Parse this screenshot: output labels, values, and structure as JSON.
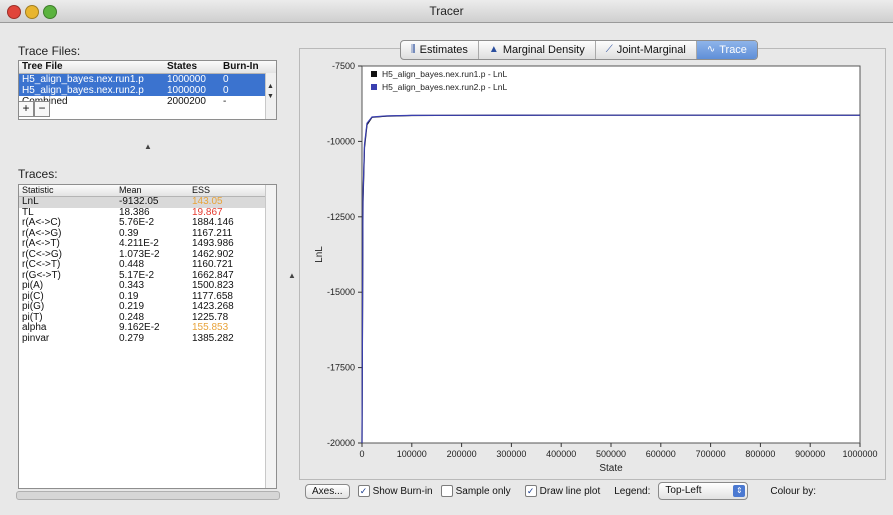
{
  "window": {
    "title": "Tracer"
  },
  "left": {
    "trace_files_label": "Trace Files:",
    "files_header": {
      "file": "Tree File",
      "states": "States",
      "burnin": "Burn-In"
    },
    "files": [
      {
        "file": "H5_align_bayes.nex.run1.p",
        "states": "1000000",
        "burnin": "0",
        "selected": true
      },
      {
        "file": "H5_align_bayes.nex.run2.p",
        "states": "1000000",
        "burnin": "0",
        "selected": true
      },
      {
        "file": "Combined",
        "states": "2000200",
        "burnin": "-",
        "selected": false
      }
    ],
    "add_label": "+",
    "remove_label": "−",
    "traces_label": "Traces:",
    "traces_header": {
      "stat": "Statistic",
      "mean": "Mean",
      "ess": "ESS"
    },
    "traces": [
      {
        "stat": "LnL",
        "mean": "-9132.05",
        "ess": "143.05",
        "ess_color": "#e8a33a"
      },
      {
        "stat": "TL",
        "mean": "18.386",
        "ess": "19.867",
        "ess_color": "#e53a2f"
      },
      {
        "stat": "r(A<->C)",
        "mean": "5.76E-2",
        "ess": "1884.146",
        "ess_color": "#111111"
      },
      {
        "stat": "r(A<->G)",
        "mean": "0.39",
        "ess": "1167.211",
        "ess_color": "#111111"
      },
      {
        "stat": "r(A<->T)",
        "mean": "4.211E-2",
        "ess": "1493.986",
        "ess_color": "#111111"
      },
      {
        "stat": "r(C<->G)",
        "mean": "1.073E-2",
        "ess": "1462.902",
        "ess_color": "#111111"
      },
      {
        "stat": "r(C<->T)",
        "mean": "0.448",
        "ess": "1160.721",
        "ess_color": "#111111"
      },
      {
        "stat": "r(G<->T)",
        "mean": "5.17E-2",
        "ess": "1662.847",
        "ess_color": "#111111"
      },
      {
        "stat": "pi(A)",
        "mean": "0.343",
        "ess": "1500.823",
        "ess_color": "#111111"
      },
      {
        "stat": "pi(C)",
        "mean": "0.19",
        "ess": "1177.658",
        "ess_color": "#111111"
      },
      {
        "stat": "pi(G)",
        "mean": "0.219",
        "ess": "1423.268",
        "ess_color": "#111111"
      },
      {
        "stat": "pi(T)",
        "mean": "0.248",
        "ess": "1225.78",
        "ess_color": "#111111"
      },
      {
        "stat": "alpha",
        "mean": "9.162E-2",
        "ess": "155.853",
        "ess_color": "#e8a33a"
      },
      {
        "stat": "pinvar",
        "mean": "0.279",
        "ess": "1385.282",
        "ess_color": "#111111"
      }
    ]
  },
  "tabs": [
    {
      "label": "Estimates",
      "icon": "estimates-icon",
      "glyph": "⫼",
      "active": false
    },
    {
      "label": "Marginal Density",
      "icon": "marginal-density-icon",
      "glyph": "▲",
      "active": false
    },
    {
      "label": "Joint-Marginal",
      "icon": "joint-marginal-icon",
      "glyph": "⟋",
      "active": false
    },
    {
      "label": "Trace",
      "icon": "trace-icon",
      "glyph": "∿",
      "active": true
    }
  ],
  "chart_data": {
    "type": "line",
    "xlabel": "State",
    "ylabel": "LnL",
    "xlim": [
      0,
      1000000
    ],
    "ylim": [
      -20000,
      -7500
    ],
    "x_ticks": [
      0,
      100000,
      200000,
      300000,
      400000,
      500000,
      600000,
      700000,
      800000,
      900000,
      1000000
    ],
    "x_tick_labels": [
      "0",
      "100000",
      "200000",
      "300000",
      "400000",
      "500000",
      "600000",
      "700000",
      "800000",
      "900000",
      "1000000"
    ],
    "y_ticks": [
      -7500,
      -10000,
      -12500,
      -15000,
      -17500,
      -20000
    ],
    "y_tick_labels": [
      "-7500",
      "-10000",
      "-12500",
      "-15000",
      "-17500",
      "-20000"
    ],
    "legend_position": "top-left",
    "series": [
      {
        "name": "H5_align_bayes.nex.run1.p - LnL",
        "color": "#111111",
        "x": [
          0,
          2000,
          5000,
          10000,
          20000,
          50000,
          100000,
          200000,
          400000,
          600000,
          800000,
          1000000
        ],
        "y": [
          -20000,
          -12000,
          -10200,
          -9450,
          -9200,
          -9160,
          -9140,
          -9135,
          -9132,
          -9130,
          -9131,
          -9132
        ]
      },
      {
        "name": "H5_align_bayes.nex.run2.p - LnL",
        "color": "#3a3fb0",
        "x": [
          0,
          2000,
          5000,
          10000,
          20000,
          50000,
          100000,
          200000,
          400000,
          600000,
          800000,
          1000000
        ],
        "y": [
          -20000,
          -11800,
          -10100,
          -9400,
          -9190,
          -9155,
          -9138,
          -9133,
          -9131,
          -9132,
          -9130,
          -9133
        ]
      }
    ]
  },
  "controls": {
    "axes_label": "Axes...",
    "show_burnin_label": "Show Burn-in",
    "show_burnin_checked": true,
    "sample_only_label": "Sample only",
    "sample_only_checked": false,
    "draw_line_label": "Draw line plot",
    "draw_line_checked": true,
    "legend_label": "Legend:",
    "legend_value": "Top-Left",
    "colour_by_label": "Colour by:"
  }
}
